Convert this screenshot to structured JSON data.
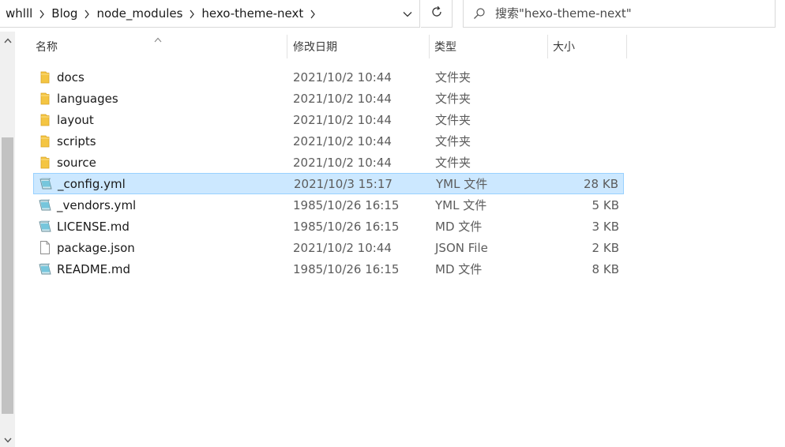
{
  "breadcrumb": {
    "items": [
      "whlll",
      "Blog",
      "node_modules",
      "hexo-theme-next"
    ]
  },
  "search": {
    "placeholder": "搜索\"hexo-theme-next\""
  },
  "columns": {
    "name": "名称",
    "date": "修改日期",
    "type": "类型",
    "size": "大小"
  },
  "files": [
    {
      "name": "docs",
      "date": "2021/10/2 10:44",
      "type": "文件夹",
      "size": "",
      "icon": "folder-icon"
    },
    {
      "name": "languages",
      "date": "2021/10/2 10:44",
      "type": "文件夹",
      "size": "",
      "icon": "folder-icon"
    },
    {
      "name": "layout",
      "date": "2021/10/2 10:44",
      "type": "文件夹",
      "size": "",
      "icon": "folder-icon"
    },
    {
      "name": "scripts",
      "date": "2021/10/2 10:44",
      "type": "文件夹",
      "size": "",
      "icon": "folder-icon"
    },
    {
      "name": "source",
      "date": "2021/10/2 10:44",
      "type": "文件夹",
      "size": "",
      "icon": "folder-icon"
    },
    {
      "name": "_config.yml",
      "date": "2021/10/3 15:17",
      "type": "YML 文件",
      "size": "28 KB",
      "icon": "notepad-file-icon",
      "selected": true
    },
    {
      "name": "_vendors.yml",
      "date": "1985/10/26 16:15",
      "type": "YML 文件",
      "size": "5 KB",
      "icon": "notepad-file-icon"
    },
    {
      "name": "LICENSE.md",
      "date": "1985/10/26 16:15",
      "type": "MD 文件",
      "size": "3 KB",
      "icon": "notepad-file-icon"
    },
    {
      "name": "package.json",
      "date": "2021/10/2 10:44",
      "type": "JSON File",
      "size": "2 KB",
      "icon": "blank-file-icon"
    },
    {
      "name": "README.md",
      "date": "1985/10/26 16:15",
      "type": "MD 文件",
      "size": "8 KB",
      "icon": "notepad-file-icon"
    }
  ],
  "colors": {
    "selection_bg": "#cce8ff",
    "selection_border": "#99d1ff",
    "folder": "#f4c542"
  }
}
